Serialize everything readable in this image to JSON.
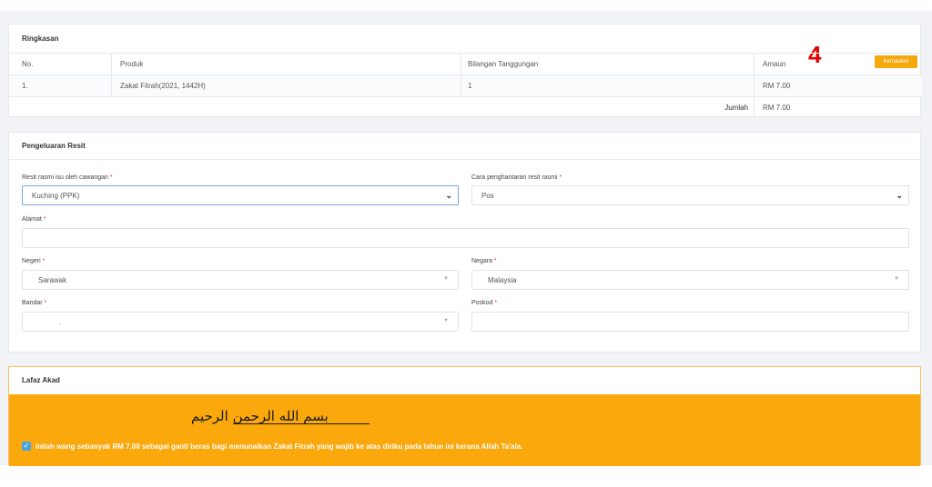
{
  "step_number": "4",
  "summary": {
    "title": "Ringkasan",
    "back_button": "Kemaskini",
    "columns": [
      "No.",
      "Produk",
      "Bilangan Tanggungan",
      "Amaun"
    ],
    "rows": [
      {
        "no": "1.",
        "produk": "Zakat Fitrah(2021, 1442H)",
        "bilangan": "1",
        "amaun": "RM 7.00"
      }
    ],
    "total_label": "Jumlah",
    "total_value": "RM 7.00"
  },
  "receipt": {
    "title": "Pengeluaran Resit",
    "branch": {
      "label": "Resit rasmi isu oleh cawangan",
      "value": "Kuching (PPK)"
    },
    "delivery": {
      "label": "Cara penghantaran resit rasmi",
      "value": "Pos"
    },
    "address": {
      "label": "Alamat",
      "value": ""
    },
    "state": {
      "label": "Negeri",
      "value": "Sarawak"
    },
    "country": {
      "label": "Negara",
      "value": "Malaysia"
    },
    "city": {
      "label": "Bandar",
      "value": "."
    },
    "postcode": {
      "label": "Poskod",
      "value": ""
    },
    "required_mark": "*"
  },
  "akad": {
    "title": "Lafaz Akad",
    "bismillah": "بسم الله الرحمن الرحيم",
    "checked": true,
    "statement": "Inilah wang sebanyak RM 7.00 sebagai ganti beras bagi menunaikan Zakat Fitrah yang wajib ke atas diriku pada tahun ini kerana Allah Ta'ala."
  },
  "colors": {
    "accent": "#fba80d",
    "button": "#f5a80c",
    "step": "#e00000",
    "checkbox": "#4aa3df"
  },
  "icons": {
    "select": "chevron-down-icon",
    "check": "check-icon"
  }
}
